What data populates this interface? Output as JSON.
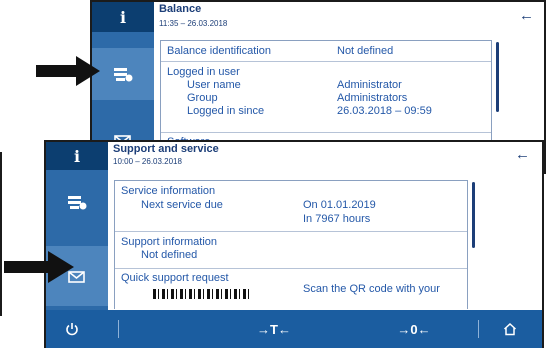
{
  "balance_screen": {
    "title": "Balance",
    "subtitle": "11:35 – 26.03.2018",
    "info_tab": "i",
    "rows": [
      {
        "label": "Balance identification",
        "value": "Not defined"
      }
    ],
    "logged_in": {
      "heading": "Logged in user",
      "items": [
        {
          "label": "User name",
          "value": "Administrator"
        },
        {
          "label": "Group",
          "value": "Administrators"
        },
        {
          "label": "Logged in since",
          "value": "26.03.2018 – 09:59"
        }
      ],
      "next_cut": "Software"
    }
  },
  "support_screen": {
    "title": "Support and service",
    "subtitle": "10:00 – 26.03.2018",
    "info_tab": "i",
    "service": {
      "heading": "Service information",
      "label": "Next service due",
      "value_line1": "On 01.01.2019",
      "value_line2": "In 7967 hours"
    },
    "support": {
      "heading": "Support information",
      "value": "Not defined"
    },
    "quick": {
      "heading": "Quick support request",
      "hint": "Scan the QR code with your"
    },
    "bottom_bar": {
      "tare_label": "→T←",
      "zero_label": "→0←"
    }
  },
  "icons": [
    "info-icon",
    "balance-icon",
    "support-icon",
    "back-arrow-icon",
    "power-icon",
    "home-icon",
    "pointer-arrow-icon"
  ]
}
